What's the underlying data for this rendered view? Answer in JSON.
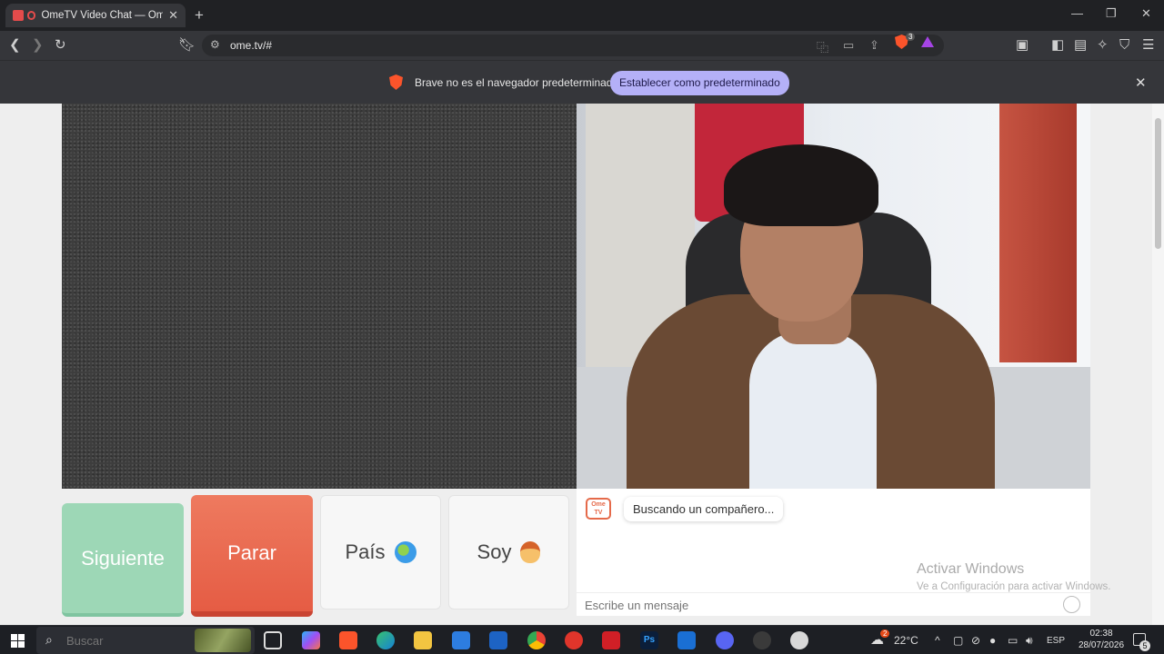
{
  "browser": {
    "tab_title": "OmeTV Video Chat — Omegle",
    "tab_close": "✕",
    "new_tab": "+",
    "url": "ome.tv/#",
    "brave_shields_count": "3"
  },
  "infobar": {
    "message": "Brave no es el navegador predeterminado",
    "set_default_label": "Establecer como predeterminado",
    "close": "✕"
  },
  "controls": {
    "next_label": "Siguiente",
    "stop_label": "Parar",
    "country_label": "País",
    "gender_label": "Soy"
  },
  "chat": {
    "logo_line1": "Ome",
    "logo_line2": "TV",
    "status_message": "Buscando un compañero...",
    "message_placeholder": "Escribe un mensaje"
  },
  "watermark": {
    "title": "Activar Windows",
    "subtitle": "Ve a Configuración para activar Windows."
  },
  "taskbar": {
    "search_placeholder": "Buscar",
    "weather_temp": "22°C",
    "language": "ESP",
    "time": "02:38",
    "date": "28/07/2026",
    "weather_badge": "2",
    "notification_count": "5"
  },
  "colors": {
    "next_button": "#9dd7b6",
    "stop_button": "#e55c44",
    "set_default_button": "#b4b0f7",
    "brave_orange": "#fb542b"
  }
}
